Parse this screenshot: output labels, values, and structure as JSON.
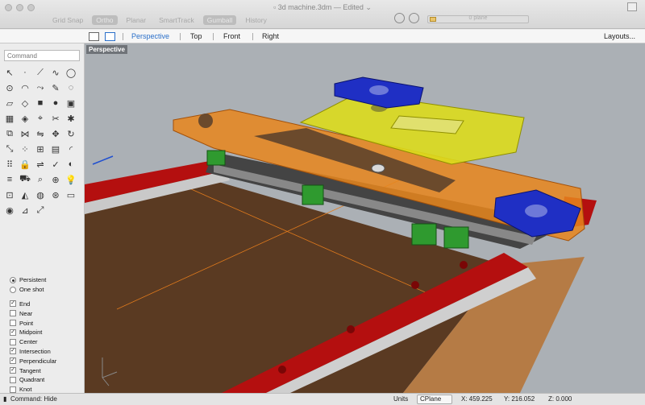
{
  "window": {
    "title": "3d machine.3dm",
    "edited": "— Edited ⌄"
  },
  "toolbar": {
    "tabs": [
      {
        "label": "Grid Snap",
        "active": false
      },
      {
        "label": "Ortho",
        "active": true
      },
      {
        "label": "Planar",
        "active": false
      },
      {
        "label": "SmartTrack",
        "active": false
      },
      {
        "label": "Gumball",
        "active": true
      },
      {
        "label": "History",
        "active": false
      }
    ],
    "layer_label": "0 plane"
  },
  "viewport_tabs": {
    "views": [
      "Perspective",
      "Top",
      "Front",
      "Right"
    ],
    "active": "Perspective",
    "layouts": "Layouts..."
  },
  "viewport": {
    "label": "Perspective"
  },
  "command": {
    "placeholder": "Command"
  },
  "tool_icons": [
    "select-arrow-icon",
    "point-icon",
    "polyline-icon",
    "curve-icon",
    "circle-icon",
    "circle-center-icon",
    "arc-icon",
    "curve-edit-icon",
    "curve-drag-icon",
    "curve-dot-icon",
    "surface-icon",
    "surface-plane-icon",
    "box-solid-icon",
    "sphere-icon",
    "extrude-icon",
    "mesh-icon",
    "render-icon",
    "edit-point-icon",
    "trim-icon",
    "explode-icon",
    "boolean-union-icon",
    "join-icon",
    "mirror-icon",
    "move-icon",
    "rotate-icon",
    "scale-icon",
    "array-icon",
    "group-icon",
    "block-icon",
    "fillet-icon",
    "dot-grid-icon",
    "lock-icon",
    "orient-icon",
    "check-icon",
    "hide-icon",
    "layer-icon",
    "car-icon",
    "analyze-icon",
    "zoom-icon",
    "bulb-icon",
    "lock-layer-icon",
    "material-icon",
    "color-wheel-icon",
    "globe-icon",
    "camera-icon",
    "render-sphere-icon",
    "pin-icon",
    "dimension-icon"
  ],
  "snap_mode": [
    {
      "label": "Persistent",
      "selected": true
    },
    {
      "label": "One shot",
      "selected": false
    }
  ],
  "osnaps": [
    {
      "label": "End",
      "checked": true
    },
    {
      "label": "Near",
      "checked": false
    },
    {
      "label": "Point",
      "checked": false
    },
    {
      "label": "Midpoint",
      "checked": true
    },
    {
      "label": "Center",
      "checked": false
    },
    {
      "label": "Intersection",
      "checked": true
    },
    {
      "label": "Perpendicular",
      "checked": true
    },
    {
      "label": "Tangent",
      "checked": true
    },
    {
      "label": "Quadrant",
      "checked": false
    },
    {
      "label": "Knot",
      "checked": false
    }
  ],
  "status": {
    "command": "Command: Hide",
    "units_label": "Units",
    "units_value": "CPlane",
    "x": "X: 459.225",
    "y": "Y: 216.052",
    "z": "Z: 0.000"
  },
  "colors": {
    "rail_red": "#b40f0f",
    "plate_orange": "#e8861c",
    "plate_yellow": "#dcdc1c",
    "motor_blue": "#1f2fc4",
    "block_green": "#2f9a2f",
    "bed_brown": "#5a3a22",
    "active_blue": "#2a6fc9"
  }
}
